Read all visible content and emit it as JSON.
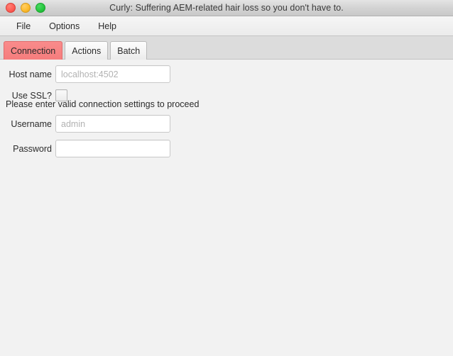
{
  "window": {
    "title": "Curly: Suffering AEM-related hair loss so you don't have to.",
    "traffic_lights": {
      "close": "close-button",
      "minimize": "minimize-button",
      "maximize": "maximize-button"
    }
  },
  "menubar": {
    "items": [
      {
        "label": "File"
      },
      {
        "label": "Options"
      },
      {
        "label": "Help"
      }
    ]
  },
  "tabs": {
    "selected_index": 0,
    "selected_color": "#f78383",
    "items": [
      {
        "label": "Connection"
      },
      {
        "label": "Actions"
      },
      {
        "label": "Batch"
      }
    ]
  },
  "connection_form": {
    "host": {
      "label": "Host name",
      "value": "",
      "placeholder": "localhost:4502"
    },
    "ssl": {
      "label": "Use SSL?",
      "checked": false
    },
    "username": {
      "label": "Username",
      "value": "",
      "placeholder": "admin"
    },
    "password": {
      "label": "Password",
      "value": "",
      "placeholder": ""
    },
    "status_message": "Please enter valid connection settings to proceed"
  }
}
